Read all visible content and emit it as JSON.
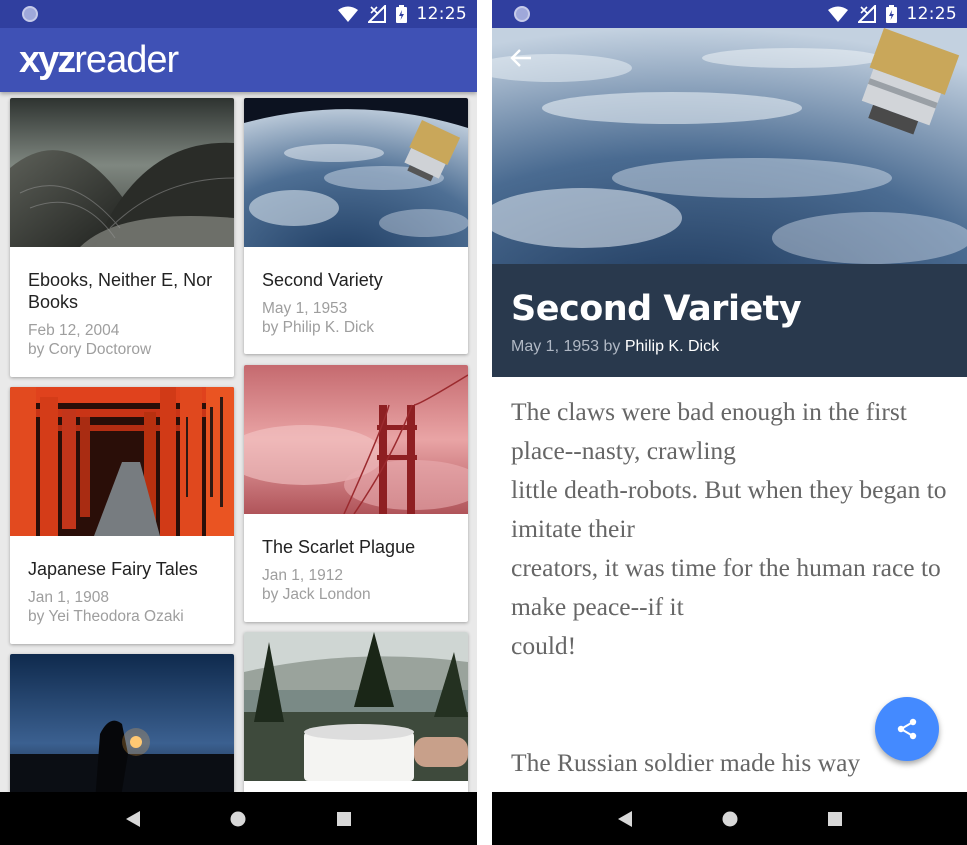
{
  "status_bar": {
    "time": "12:25"
  },
  "list_screen": {
    "app_logo": {
      "bold": "xyz",
      "regular": "reader"
    },
    "articles": [
      {
        "title": "Ebooks, Neither E, Nor Books",
        "date": "Feb 12, 2004",
        "author": "by Cory Doctorow"
      },
      {
        "title": "Second Variety",
        "date": "May 1, 1953",
        "author": "by Philip K. Dick"
      },
      {
        "title": "Japanese Fairy Tales",
        "date": "Jan 1, 1908",
        "author": "by Yei Theodora Ozaki"
      },
      {
        "title": "The Scarlet Plague",
        "date": "Jan 1, 1912",
        "author": "by Jack London"
      }
    ]
  },
  "detail_screen": {
    "title": "Second Variety",
    "date_prefix": "May 1, 1953 by ",
    "author": "Philip K. Dick",
    "body": [
      "The claws were bad enough in the first place--nasty, crawling",
      "little death-robots. But when they began to imitate their",
      "creators, it was time for the human race to make peace--if it",
      "could!",
      "",
      "The Russian soldier made his way"
    ]
  },
  "icons": [
    "back-arrow-icon",
    "share-icon",
    "wifi-icon",
    "no-signal-icon",
    "battery-charging-icon",
    "nav-back-icon",
    "nav-home-icon",
    "nav-recents-icon"
  ],
  "colors": {
    "status_bar": "#303f9f",
    "app_bar": "#3f51b5",
    "title_panel": "#29394d",
    "fab": "#448aff"
  }
}
